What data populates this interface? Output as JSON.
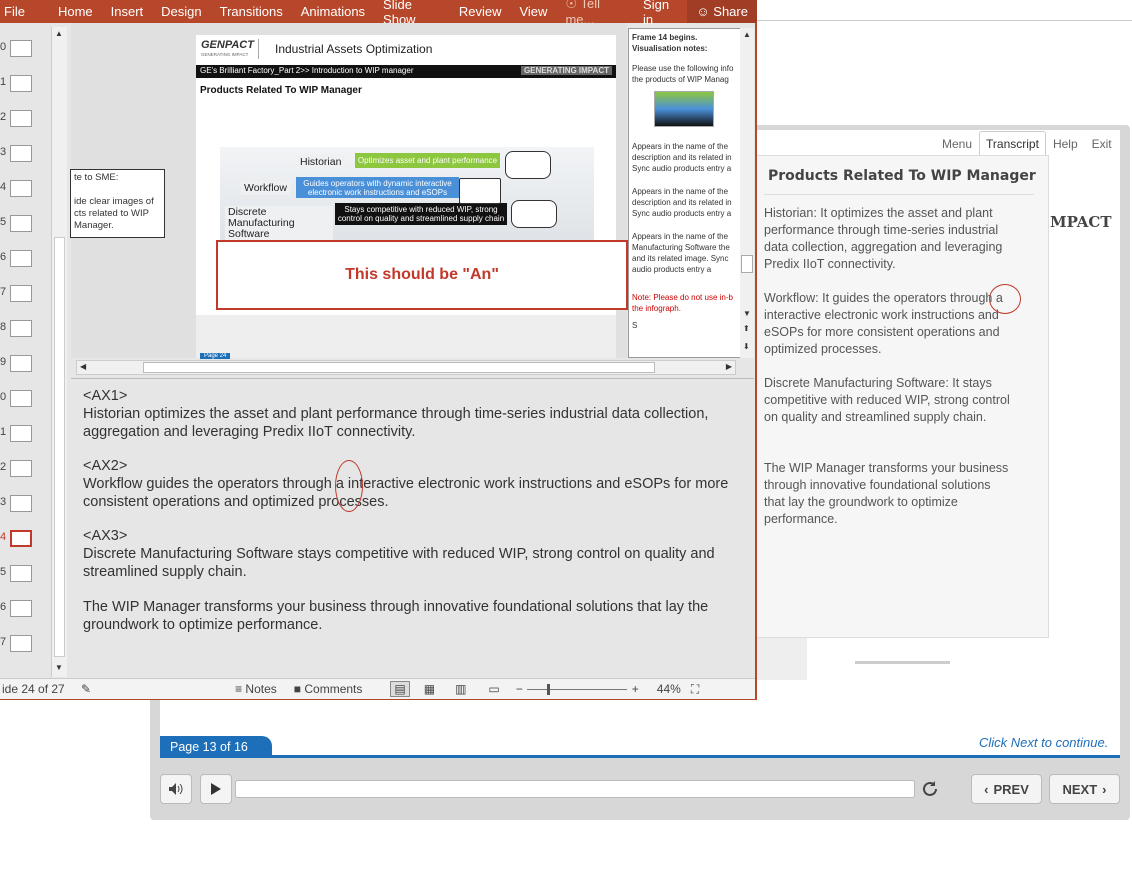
{
  "player": {
    "tabs": [
      "Menu",
      "Transcript",
      "Help",
      "Exit"
    ],
    "transcript_title": "Products Related To WIP Manager",
    "transcript": [
      "Historian: It optimizes the asset and plant performance through time-series industrial data collection, aggregation and leveraging Predix IIoT connectivity.",
      "Workflow: It guides the operators through a interactive electronic work instructions and eSOPs for more consistent operations  and optimized processes.",
      "Discrete Manufacturing Software: It stays competitive with reduced WIP, strong control on quality and streamlined supply chain.",
      "The WIP Manager transforms your business through innovative foundational solutions that lay the groundwork to optimize performance."
    ],
    "logo_fragment": "MPACT",
    "page_label": "Page 13 of 16",
    "click_next": "Click  Next to continue.",
    "prev_label": "PREV",
    "next_label": "NEXT"
  },
  "ppt": {
    "ribbon": [
      "File",
      "Home",
      "Insert",
      "Design",
      "Transitions",
      "Animations",
      "Slide Show",
      "Review",
      "View"
    ],
    "tellme": "Tell me...",
    "signin": "Sign in",
    "share": "Share",
    "thumb_numbers": [
      "0",
      "1",
      "2",
      "3",
      "4",
      "5",
      "6",
      "7",
      "8",
      "9",
      "0",
      "1",
      "2",
      "3",
      "4",
      "5",
      "6",
      "7"
    ],
    "selected_thumb": 14,
    "sme_note": "te to SME:\n\nide clear images of cts related to WIP Manager.",
    "slide": {
      "logo": "GENPACT",
      "logo_tag": "GENERATING IMPACT",
      "title": "Industrial Assets Optimization",
      "bar_text": "GE's Brilliant Factory_Part 2>> Introduction to WIP manager",
      "bar_right": "GENERATING IMPACT",
      "heading": "Products Related To WIP Manager",
      "items": [
        {
          "label": "Historian",
          "desc": "Optimizes asset and plant performance",
          "color": "#8dc63f"
        },
        {
          "label": "Workflow",
          "desc": "Guides operators with dynamic interactive electronic work instructions and eSOPs",
          "color": "#4a90d9"
        },
        {
          "label": "Discrete Manufacturing Software",
          "desc": "Stays competitive with reduced WIP, strong control on quality and streamlined supply chain",
          "color": "#111111"
        }
      ],
      "callout": "This should be \"An\"",
      "page_tag": "Page 24"
    },
    "side_notes": {
      "line1": "Frame 14 begins.",
      "line2": "Visualisation notes:",
      "p1": "Please use the following info the products of WIP Manag",
      "p2": "Appears in the name of the description and its related in Sync audio products entry a",
      "p3": "Appears in the name of the description and its related in Sync audio products entry a",
      "p4": "Appears in the name of the Manufacturing Software the and its related image. Sync audio products entry a",
      "red": "Note: Please do not use in-b the infograph.",
      "tail": "S"
    },
    "notes": [
      {
        "tag": "<AX1>",
        "text": "Historian optimizes the asset and plant performance through time-series industrial data collection, aggregation and leveraging Predix IIoT connectivity."
      },
      {
        "tag": "<AX2>",
        "text": "Workflow guides the operators through a interactive electronic work instructions and eSOPs for more consistent operations  and optimized processes."
      },
      {
        "tag": "<AX3>",
        "text": "Discrete Manufacturing Software stays competitive with reduced WIP, strong control on quality and streamlined supply chain."
      },
      {
        "tag": "",
        "text": "The WIP Manager transforms your business through innovative foundational solutions that lay the groundwork to optimize performance."
      }
    ],
    "status": {
      "slide_count": "ide 24 of 27",
      "notes": "Notes",
      "comments": "Comments",
      "zoom": "44%"
    }
  }
}
